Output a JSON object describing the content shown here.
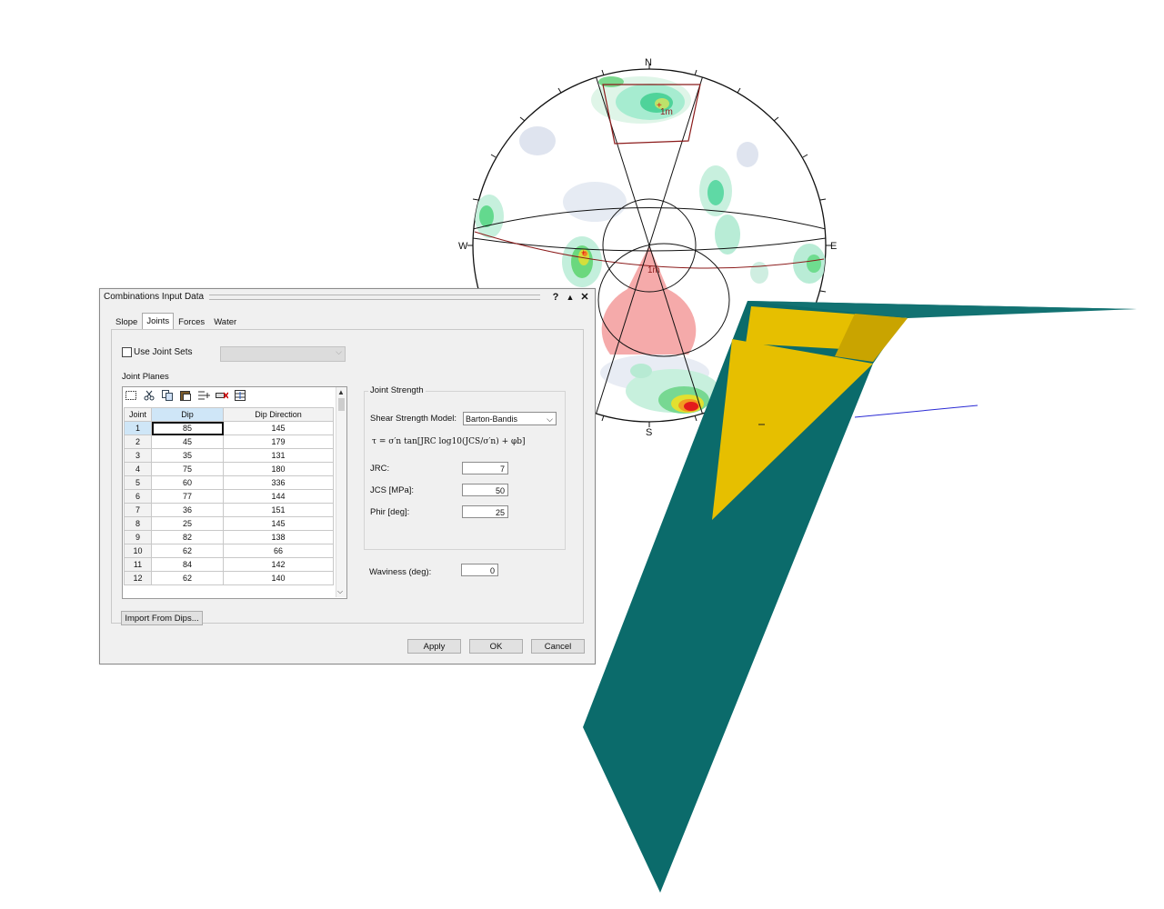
{
  "stereonet": {
    "compass": {
      "north": "N",
      "south": "S",
      "east": "E",
      "west": "W"
    },
    "annotations": [
      "1m",
      "1m"
    ],
    "colors": {
      "plane": "#8b1a1a",
      "window": "#f4a6a6",
      "contour_low": "#dde3ef",
      "contour_mid": "#9fe3c9",
      "contour_high": "#e31a1c"
    }
  },
  "model": {
    "colors": {
      "slope": "#0b6b6b",
      "wedge": "#e6bf00",
      "wedge_dark": "#c9a400",
      "axis": "#2a2ad4"
    }
  },
  "dialog": {
    "title": "Combinations Input Data",
    "help_button": "?",
    "collapse_button": "▲",
    "close_button": "✕",
    "tabs": [
      "Slope",
      "Joints",
      "Forces",
      "Water"
    ],
    "active_tab": "Joints",
    "use_joint_sets_label": "Use Joint Sets",
    "use_joint_sets_checked": false,
    "joint_planes_label": "Joint Planes",
    "table": {
      "headers": [
        "Joint",
        "Dip",
        "Dip Direction"
      ],
      "rows": [
        [
          "1",
          "85",
          "145"
        ],
        [
          "2",
          "45",
          "179"
        ],
        [
          "3",
          "35",
          "131"
        ],
        [
          "4",
          "75",
          "180"
        ],
        [
          "5",
          "60",
          "336"
        ],
        [
          "6",
          "77",
          "144"
        ],
        [
          "7",
          "36",
          "151"
        ],
        [
          "8",
          "25",
          "145"
        ],
        [
          "9",
          "82",
          "138"
        ],
        [
          "10",
          "62",
          "66"
        ],
        [
          "11",
          "84",
          "142"
        ],
        [
          "12",
          "62",
          "140"
        ]
      ]
    },
    "joint_strength": {
      "group_label": "Joint Strength",
      "model_label": "Shear Strength Model:",
      "model_value": "Barton-Bandis",
      "formula": "τ = σ′n tan[JRC log10(JCS/σ′n) + φb]",
      "jrc_label": "JRC:",
      "jrc_value": "7",
      "jcs_label": "JCS [MPa]:",
      "jcs_value": "50",
      "phir_label": "Phir [deg]:",
      "phir_value": "25"
    },
    "waviness_label": "Waviness (deg):",
    "waviness_value": "0",
    "import_button": "Import From Dips...",
    "apply_button": "Apply",
    "ok_button": "OK",
    "cancel_button": "Cancel"
  }
}
